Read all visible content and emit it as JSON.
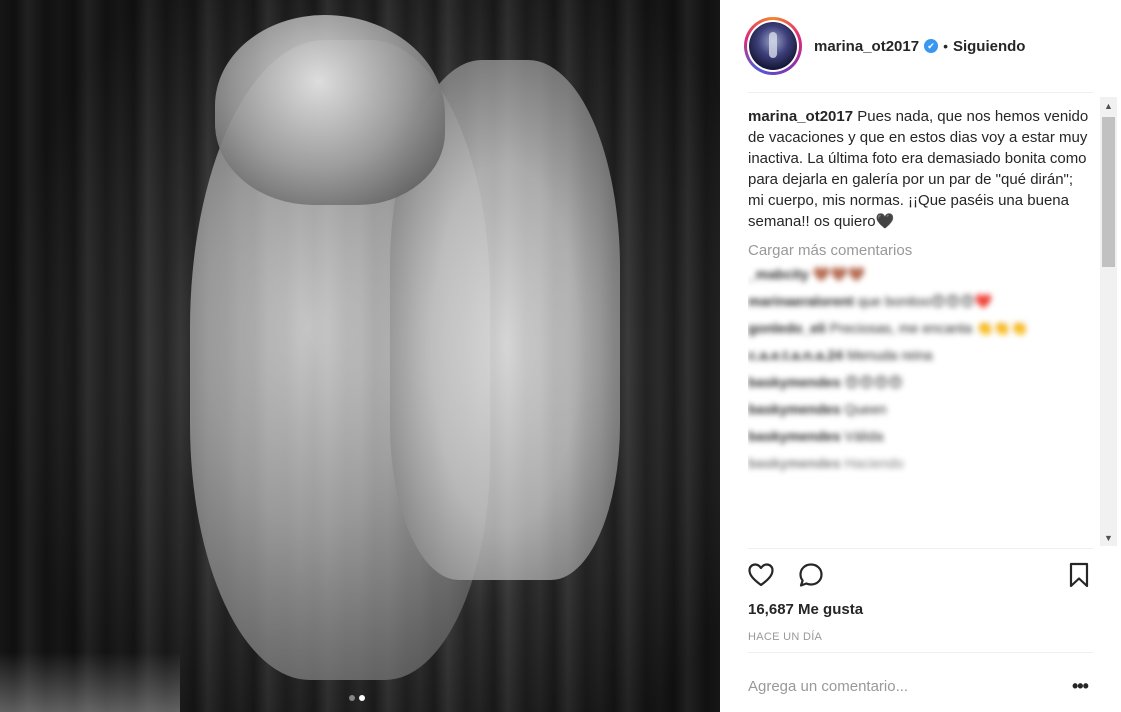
{
  "post": {
    "carousel": {
      "count": 2,
      "active_index": 1
    }
  },
  "header": {
    "username": "marina_ot2017",
    "verified_glyph": "✔",
    "separator": "•",
    "follow_status": "Siguiendo"
  },
  "caption": {
    "username": "marina_ot2017",
    "text": "Pues nada, que nos hemos venido de vacaciones y que en estos dias voy a estar muy inactiva. La última foto era demasiado bonita como para dejarla en galería por un par de \"qué dirán\"; mi cuerpo, mis normas. ¡¡Que paséis una buena semana!! os quiero🖤"
  },
  "comments": {
    "load_more": "Cargar más comentarios",
    "items": [
      {
        "user": "_mabcity",
        "text": "🤎🤎🤎"
      },
      {
        "user": "marinaeralorent",
        "text": "que bonitoo😍😍😍❤️"
      },
      {
        "user": "gonledo_eli",
        "text": "Preciosas, me encanta 👏👏👏"
      },
      {
        "user": "c.a.e.t.a.n.a.24",
        "text": "Menuda reina"
      },
      {
        "user": "baskymendes",
        "text": "😍😍😍😍"
      },
      {
        "user": "baskymendes",
        "text": "Queen"
      },
      {
        "user": "baskymendes",
        "text": "Válida"
      },
      {
        "user": "baskymendes",
        "text": "Haciendo"
      }
    ]
  },
  "actions": {
    "like_icon": "heart-icon",
    "comment_icon": "comment-icon",
    "save_icon": "bookmark-icon"
  },
  "likes_text": "16,687 Me gusta",
  "time_text": "HACE UN DÍA",
  "comment_input": {
    "placeholder": "Agrega un comentario..."
  },
  "more_options": "•••",
  "scrollbar": {
    "up": "▲",
    "down": "▼"
  }
}
